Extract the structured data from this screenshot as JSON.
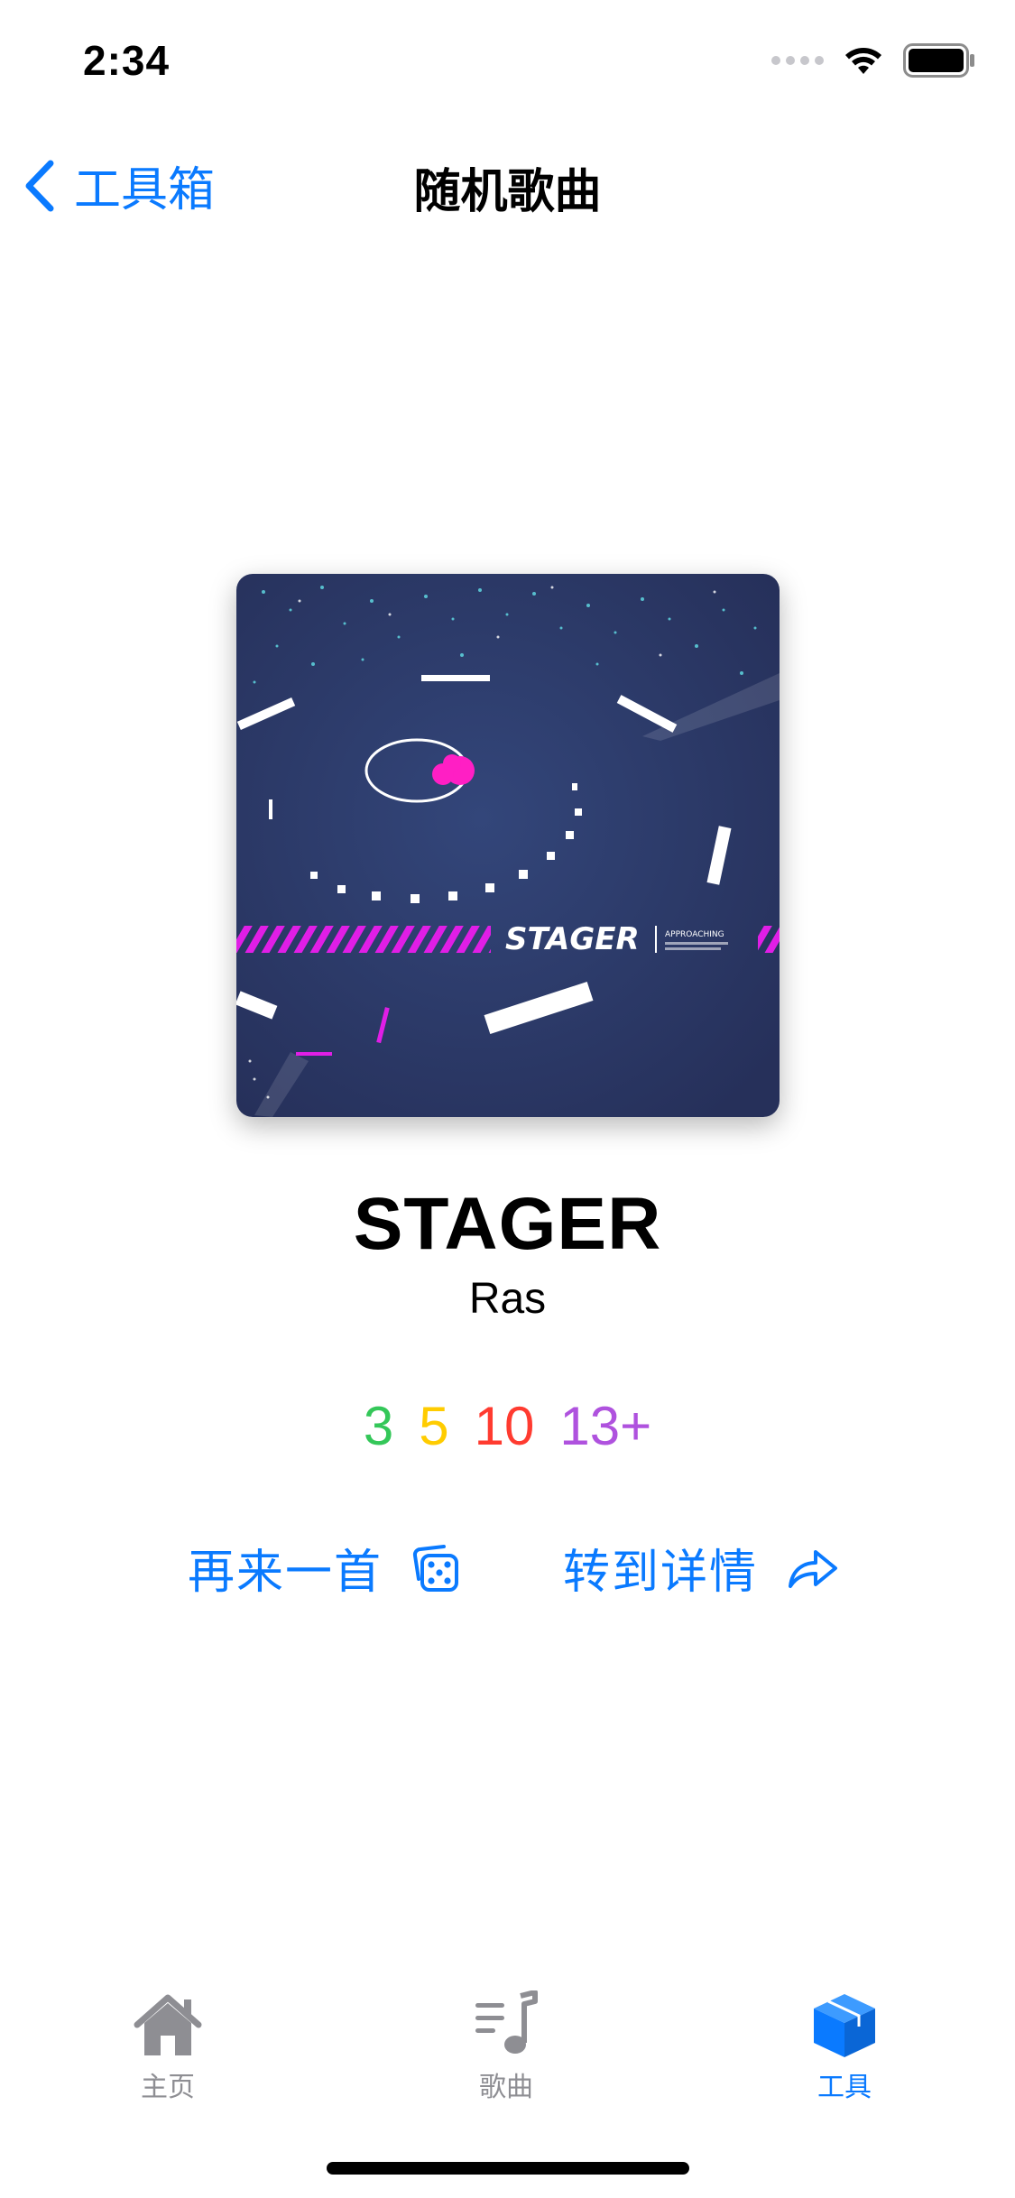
{
  "status_bar": {
    "time": "2:34"
  },
  "nav": {
    "back_label": "工具箱",
    "title": "随机歌曲"
  },
  "song": {
    "title": "STAGER",
    "artist": "Ras",
    "cover_text": "STAGER",
    "cover_subtext": "APPROACHING",
    "difficulties": [
      "3",
      "5",
      "10",
      "13+"
    ]
  },
  "actions": {
    "random_label": "再来一首",
    "detail_label": "转到详情"
  },
  "tabs": [
    {
      "label": "主页",
      "icon": "house-icon"
    },
    {
      "label": "歌曲",
      "icon": "music-list-icon"
    },
    {
      "label": "工具",
      "icon": "cube-icon",
      "active": true
    }
  ],
  "colors": {
    "accent": "#0a7aff",
    "easy": "#34c759",
    "normal": "#ffcc00",
    "hard": "#ff3b30",
    "expert": "#af52de",
    "cover_bg": "#2c3a66",
    "cover_stripe": "#e01ee6"
  }
}
